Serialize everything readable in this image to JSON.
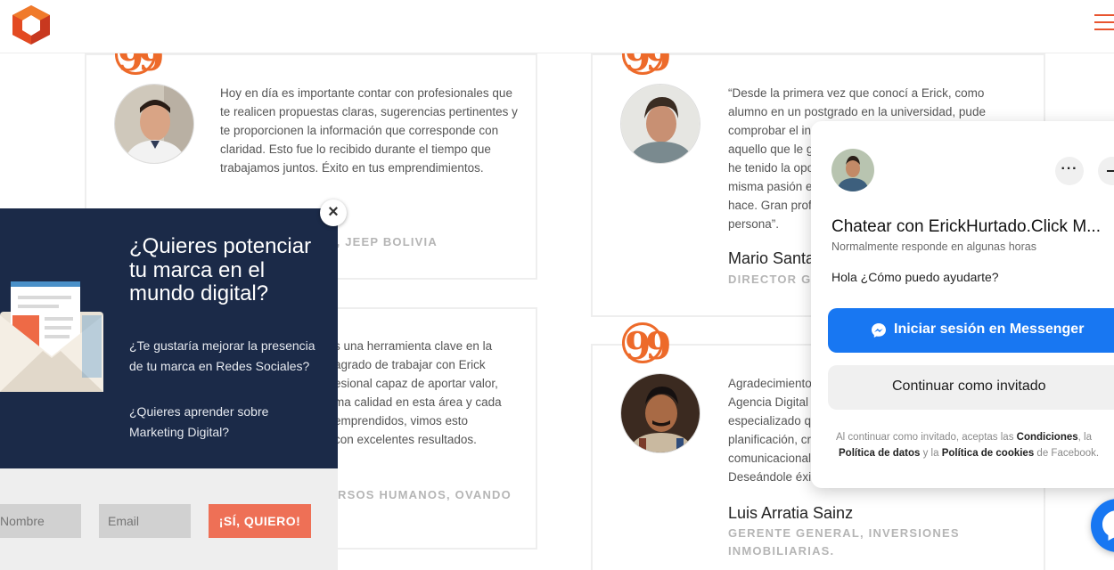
{
  "colors": {
    "accent": "#ed6a2a",
    "popup_bg": "#1b2a48",
    "cta": "#ee7056",
    "messenger": "#1877f2"
  },
  "header": {
    "logo_icon": "hexagon-logo-icon",
    "menu_icon": "hamburger-menu-icon"
  },
  "testimonials": [
    {
      "quote": "Hoy en día es importante contar con profesionales que te realicen propuestas claras, sugerencias pertinentes y te proporcionen la información que corresponde con claridad. Esto fue lo recibido durante el tiempo que trabajamos juntos. Éxito en tus emprendimientos.",
      "role_visible": "A, JEEP BOLIVIA"
    },
    {
      "quote": "“Desde la primera vez que conocí a Erick, como alumno en un postgrado en la universidad, pude comprobar el in aquello que le g he tenido la opo misma pasión e hace. Gran prof persona”.",
      "lines": [
        "“Desde la primera vez que conocí a Erick, como",
        "alumno en un postgrado en la universidad, pude",
        "comprobar el in",
        "aquello que le g",
        "he tenido la opo",
        "misma pasión e",
        "hace. Gran prof",
        "persona”."
      ],
      "name": "Mario Santa",
      "role": "DIRECTOR GE"
    },
    {
      "lines": [
        "s una herramienta clave en la",
        "agrado de trabajar con Erick",
        "esional capaz de aportar valor,",
        "ma calidad en esta área y cada",
        "emprendidos, vimos esto",
        "con excelentes resultados."
      ],
      "role_visible": "RSOS HUMANOS, OVANDO"
    },
    {
      "lines": [
        "Agradecimiento",
        "Agencia Digital",
        "especializado q",
        "planificación, cr",
        "comunicacional",
        "Deseándole éxi"
      ],
      "name": "Luis Arratia Sainz",
      "role_lines": [
        "GERENTE GENERAL, INVERSIONES",
        "INMOBILIARIAS."
      ]
    }
  ],
  "popup": {
    "title": "¿Quieres potenciar tu marca en el mundo digital?",
    "text1": "¿Te gustaría mejorar la presencia de tu marca en Redes Sociales?",
    "text2": "¿Quieres aprender sobre Marketing Digital?",
    "name_placeholder": "Nombre",
    "email_placeholder": "Email",
    "cta_label": "¡SÍ, QUIERO!",
    "close_label": "×"
  },
  "chat": {
    "title": "Chatear con ErickHurtado.Click M...",
    "subtitle": "Normalmente responde en algunas horas",
    "greeting": "Hola ¿Cómo puedo ayudarte?",
    "login_label": "Iniciar sesión en Messenger",
    "guest_label": "Continuar como invitado",
    "more_label": "···",
    "legal_1": "Al continuar como invitado, aceptas las ",
    "legal_conditions": "Condiciones",
    "legal_2": ", la",
    "legal_privacy": "Política de datos",
    "legal_3": " y la ",
    "legal_cookies": "Política de cookies",
    "legal_4": " de Facebook."
  }
}
